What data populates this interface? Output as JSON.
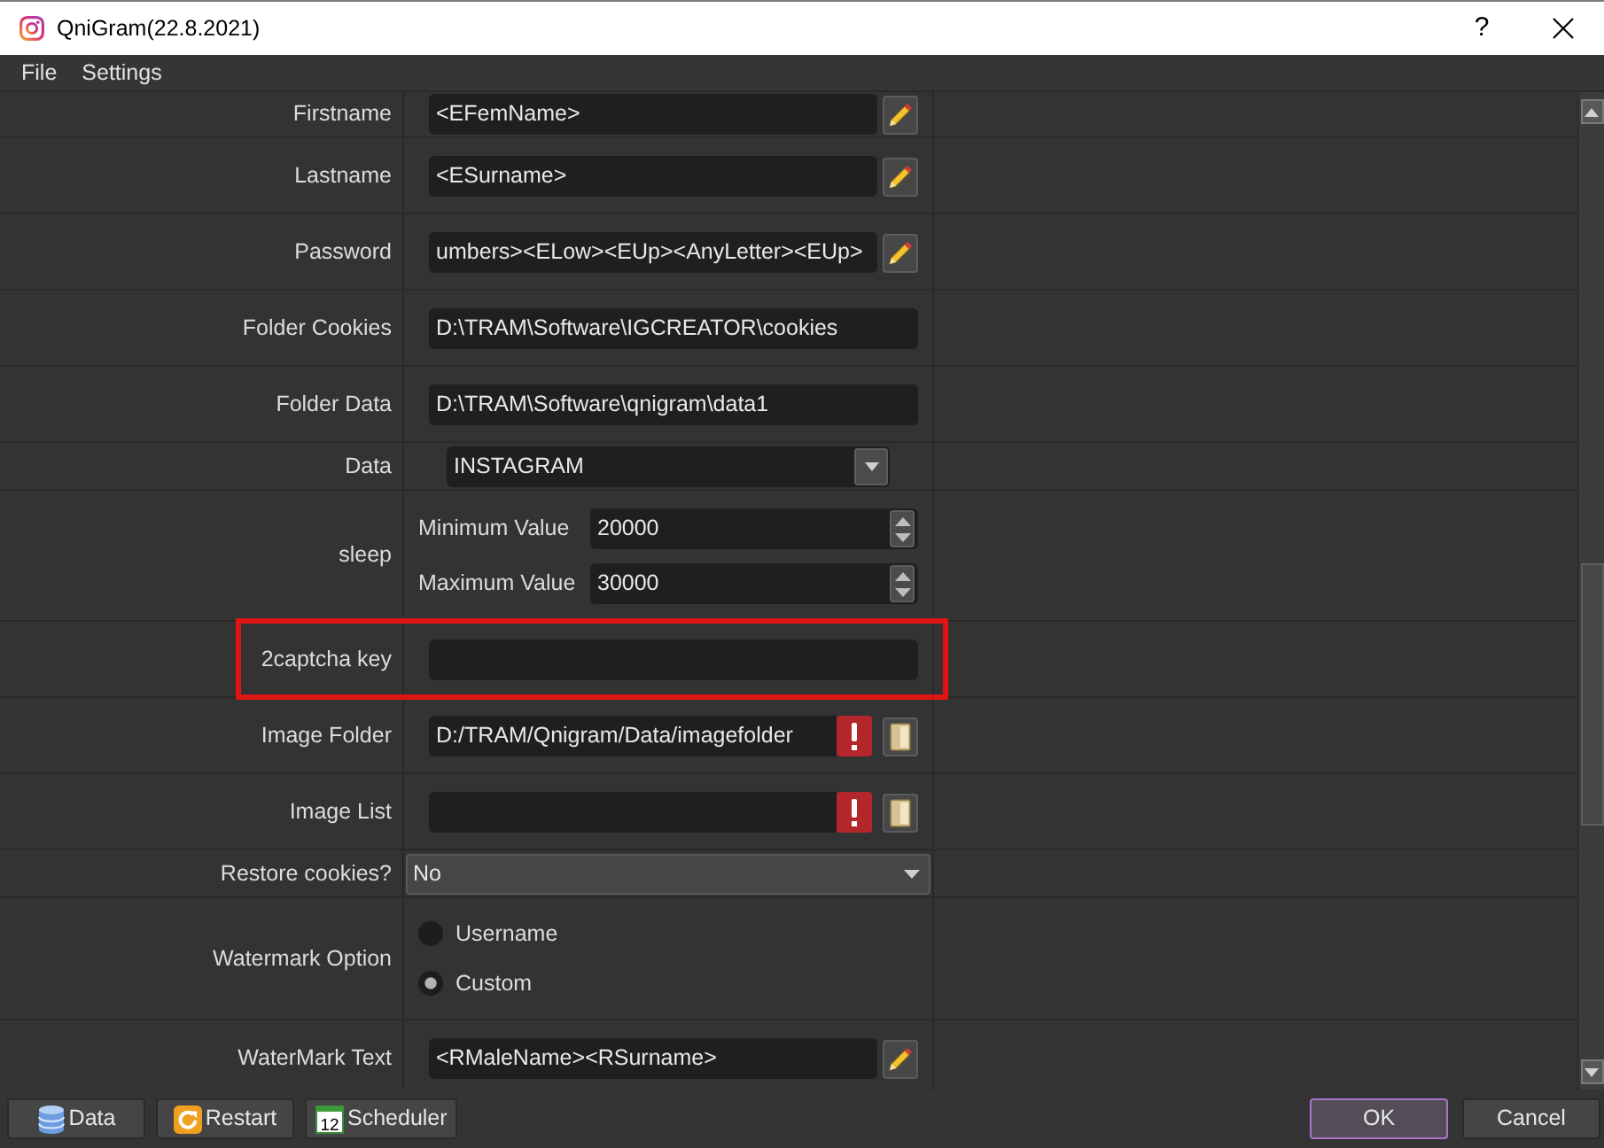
{
  "window": {
    "title": "QniGram(22.8.2021)",
    "help": "?"
  },
  "menu": [
    {
      "label": "File"
    },
    {
      "label": "Settings"
    }
  ],
  "fields": [
    {
      "kind": "edit",
      "label": "Firstname",
      "value": "<EFemName>",
      "highlighted": false
    },
    {
      "kind": "edit",
      "label": "Lastname",
      "value": "<ESurname>",
      "highlighted": false
    },
    {
      "kind": "edit",
      "label": "Password",
      "value": "umbers><ELow><EUp><AnyLetter><EUp>",
      "highlighted": false
    },
    {
      "kind": "text",
      "label": "Folder Cookies",
      "value": "D:\\TRAM\\Software\\IGCREATOR\\cookies",
      "highlighted": false
    },
    {
      "kind": "text",
      "label": "Folder Data",
      "value": "D:\\TRAM\\Software\\qnigram\\data1",
      "highlighted": false
    },
    {
      "kind": "select",
      "label": "Data",
      "value": "INSTAGRAM",
      "highlighted": false
    },
    {
      "kind": "range",
      "label": "sleep",
      "items": [
        {
          "label": "Minimum Value",
          "value": "20000"
        },
        {
          "label": "Maximum Value",
          "value": "30000"
        }
      ],
      "highlighted": false
    },
    {
      "kind": "text",
      "label": "2captcha key",
      "highlighted": true
    },
    {
      "kind": "path",
      "label": "Image Folder",
      "value": "D:/TRAM/Qnigram/Data/imagefolder",
      "warning": true,
      "highlighted": false
    },
    {
      "kind": "path",
      "label": "Image List",
      "warning": true,
      "highlighted": false
    },
    {
      "kind": "combo",
      "label": "Restore cookies?",
      "value": "No",
      "highlighted": false
    },
    {
      "kind": "radio",
      "label": "Watermark Option",
      "options": [
        {
          "label": "Username",
          "selected": false
        },
        {
          "label": "Custom",
          "selected": true
        }
      ],
      "highlighted": false
    },
    {
      "kind": "edit",
      "label": "WaterMark Text",
      "value": "<RMaleName><RSurname>",
      "highlighted": false
    }
  ],
  "footer": {
    "left": [
      {
        "kind": "database",
        "label": "Data"
      },
      {
        "kind": "refresh",
        "label": "Restart"
      },
      {
        "kind": "calendar",
        "label": "Scheduler",
        "icon_text": "12"
      }
    ],
    "right": [
      {
        "label": "OK",
        "default": true
      },
      {
        "label": "Cancel",
        "default": false
      }
    ]
  }
}
